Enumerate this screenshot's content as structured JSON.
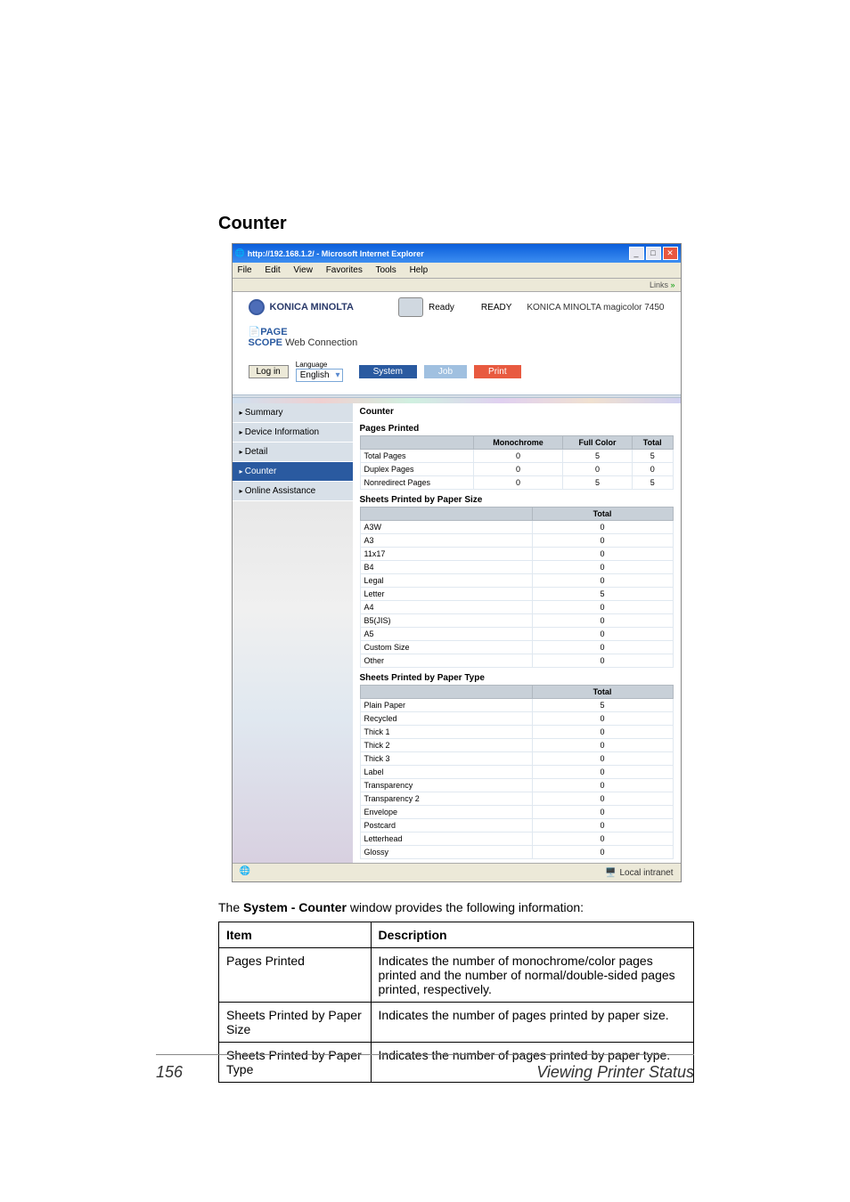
{
  "section_title": "Counter",
  "browser": {
    "title": "http://192.168.1.2/ - Microsoft Internet Explorer",
    "menu": [
      "File",
      "Edit",
      "View",
      "Favorites",
      "Tools",
      "Help"
    ],
    "links_label": "Links",
    "status_text": "Local intranet"
  },
  "header": {
    "brand": "KONICA MINOLTA",
    "ready_badge": "Ready",
    "status": "READY",
    "device": "KONICA MINOLTA magicolor 7450",
    "pagescope": "Web Connection",
    "login_btn": "Log in",
    "language_label": "Language",
    "language_value": "English",
    "tabs": {
      "system": "System",
      "job": "Job",
      "print": "Print"
    }
  },
  "nav": {
    "items": [
      {
        "label": "Summary"
      },
      {
        "label": "Device Information"
      },
      {
        "label": "Detail"
      },
      {
        "label": "Counter",
        "active": true
      },
      {
        "label": "Online Assistance"
      }
    ]
  },
  "panel": {
    "title": "Counter",
    "pages_printed": {
      "title": "Pages Printed",
      "headers": [
        "",
        "Monochrome",
        "Full Color",
        "Total"
      ],
      "rows": [
        {
          "label": "Total Pages",
          "mono": "0",
          "color": "5",
          "total": "5"
        },
        {
          "label": "Duplex Pages",
          "mono": "0",
          "color": "0",
          "total": "0"
        },
        {
          "label": "Nonredirect Pages",
          "mono": "0",
          "color": "5",
          "total": "5"
        }
      ]
    },
    "by_size": {
      "title": "Sheets Printed by Paper Size",
      "headers": [
        "",
        "Total"
      ],
      "rows": [
        {
          "label": "A3W",
          "total": "0"
        },
        {
          "label": "A3",
          "total": "0"
        },
        {
          "label": "11x17",
          "total": "0"
        },
        {
          "label": "B4",
          "total": "0"
        },
        {
          "label": "Legal",
          "total": "0"
        },
        {
          "label": "Letter",
          "total": "5"
        },
        {
          "label": "A4",
          "total": "0"
        },
        {
          "label": "B5(JIS)",
          "total": "0"
        },
        {
          "label": "A5",
          "total": "0"
        },
        {
          "label": "Custom Size",
          "total": "0"
        },
        {
          "label": "Other",
          "total": "0"
        }
      ]
    },
    "by_type": {
      "title": "Sheets Printed by Paper Type",
      "headers": [
        "",
        "Total"
      ],
      "rows": [
        {
          "label": "Plain Paper",
          "total": "5"
        },
        {
          "label": "Recycled",
          "total": "0"
        },
        {
          "label": "Thick 1",
          "total": "0"
        },
        {
          "label": "Thick 2",
          "total": "0"
        },
        {
          "label": "Thick 3",
          "total": "0"
        },
        {
          "label": "Label",
          "total": "0"
        },
        {
          "label": "Transparency",
          "total": "0"
        },
        {
          "label": "Transparency 2",
          "total": "0"
        },
        {
          "label": "Envelope",
          "total": "0"
        },
        {
          "label": "Postcard",
          "total": "0"
        },
        {
          "label": "Letterhead",
          "total": "0"
        },
        {
          "label": "Glossy",
          "total": "0"
        }
      ]
    }
  },
  "desc": {
    "prefix": "The ",
    "bold": "System - Counter",
    "suffix": " window provides the following information:"
  },
  "table": {
    "h1": "Item",
    "h2": "Description",
    "rows": [
      {
        "item": "Pages Printed",
        "desc": "Indicates the number of monochrome/color pages printed and the number of normal/double-sided pages printed, respectively."
      },
      {
        "item": "Sheets Printed by Paper Size",
        "desc": "Indicates the number of pages printed by paper size."
      },
      {
        "item": "Sheets Printed by Paper Type",
        "desc": "Indicates the number of pages printed by paper type."
      }
    ]
  },
  "footer": {
    "page_num": "156",
    "section": "Viewing Printer Status"
  }
}
